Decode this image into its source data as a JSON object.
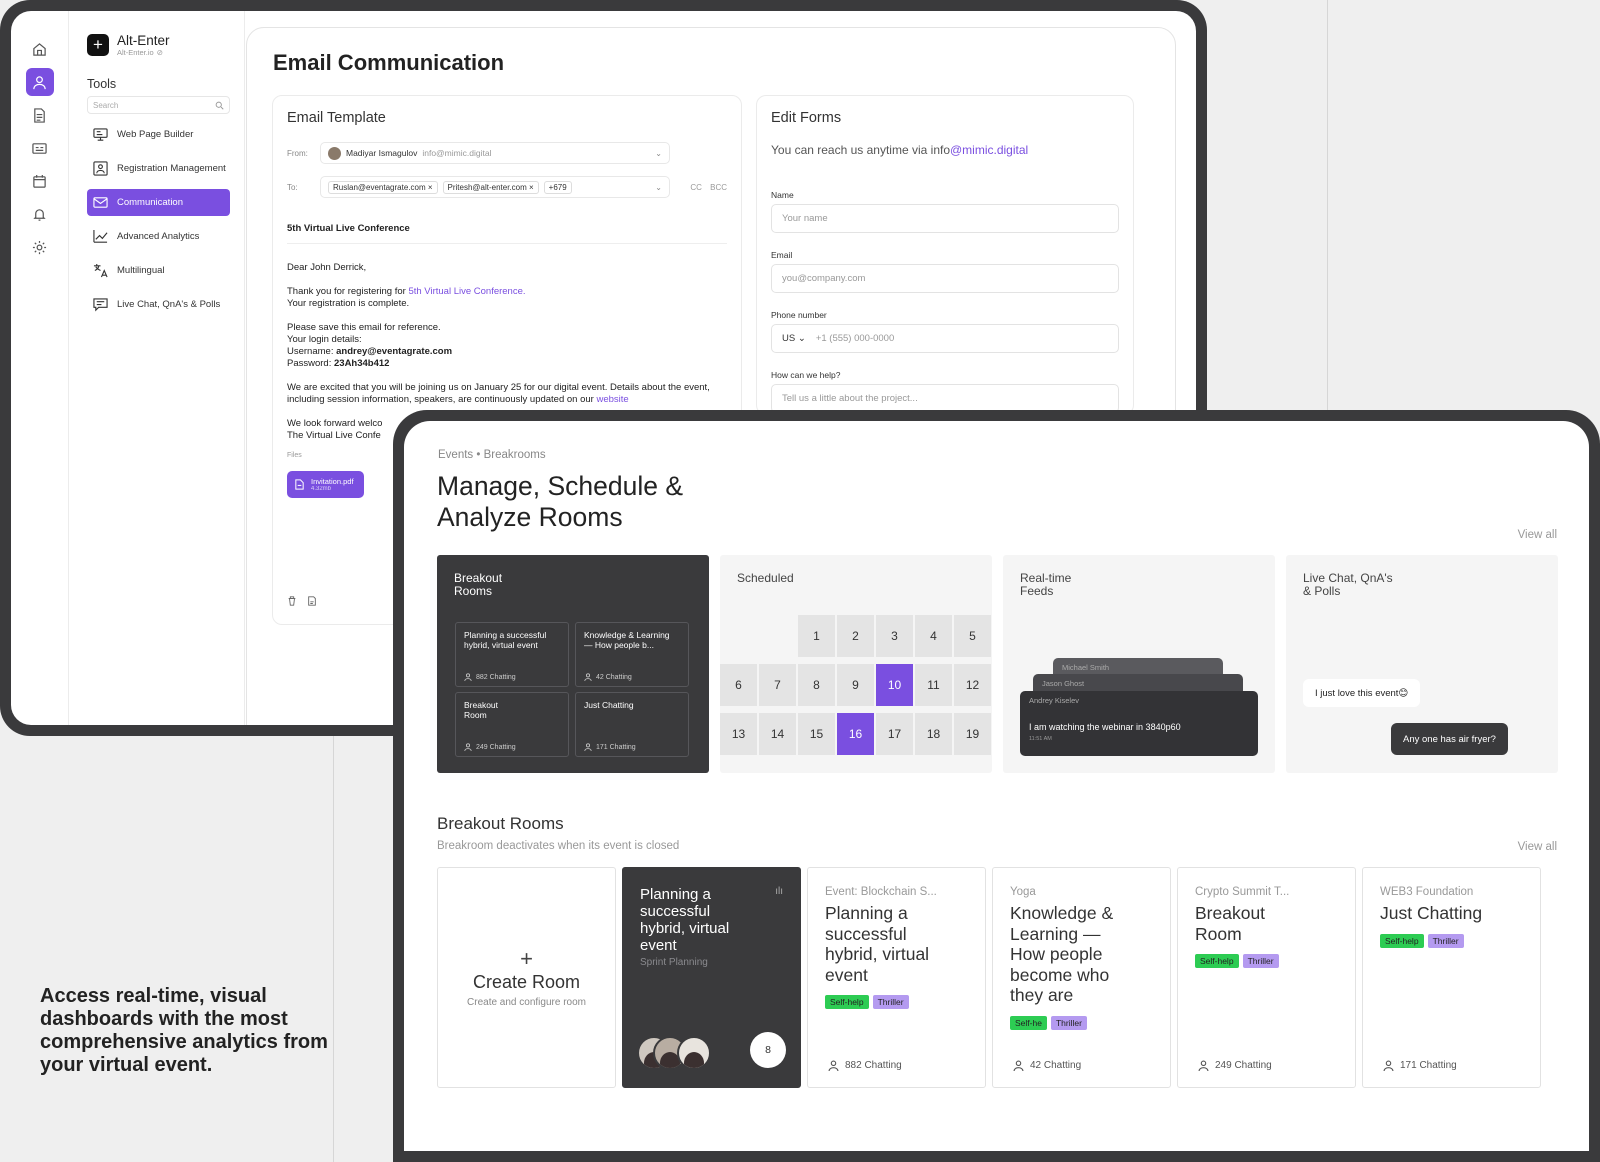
{
  "workspace": {
    "brand_name": "Alt-Enter",
    "brand_url": "Alt-Enter.io",
    "tools_title": "Tools",
    "search_placeholder": "Search",
    "tools": [
      {
        "label": "Web Page Builder",
        "icon": "monitor-icon"
      },
      {
        "label": "Registration Management",
        "icon": "registration-icon"
      },
      {
        "label": "Communication",
        "icon": "mail-icon",
        "active": true
      },
      {
        "label": "Advanced Analytics",
        "icon": "trend-icon"
      },
      {
        "label": "Multilingual",
        "icon": "translate-icon"
      },
      {
        "label": "Live Chat, QnA's & Polls",
        "icon": "chat-icon"
      }
    ],
    "rail_icons": [
      "home-icon",
      "user-icon",
      "document-icon",
      "ticket-icon",
      "calendar-icon",
      "bell-icon",
      "gear-icon"
    ],
    "accent": "#7a4fe0"
  },
  "email": {
    "page_title": "Email Communication",
    "template_title": "Email Template",
    "from_label": "From:",
    "from_name": "Madiyar Ismagulov",
    "from_email": "info@mimic.digital",
    "to_label": "To:",
    "to_chips": [
      "Ruslan@eventagrate.com ×",
      "Pritesh@alt-enter.com ×",
      "+679"
    ],
    "cc": "CC",
    "bcc": "BCC",
    "subject": "5th Virtual Live Conference",
    "greeting": "Dear John Derrick,",
    "thanks_prefix": "Thank you for registering for ",
    "thanks_link": "5th Virtual Live Conference.",
    "registration_complete": "Your registration is complete.",
    "save_line": "Please save this email for reference.",
    "login_details": "Your login details:",
    "username_label": "Username: ",
    "username": "andrey@eventagrate.com",
    "password_label": "Password: ",
    "password": "23Ah34b412",
    "excited_text": "We are excited that you will be joining us on January 25 for our digital event. Details about the event,  including session information, speakers, are continuously updated on our ",
    "website_link": "website",
    "look_forward": "We look forward welco",
    "signoff": "The Virtual Live Confe",
    "files_label": "Files",
    "file_name": "Invitation.pdf",
    "file_size": "4.32mb"
  },
  "forms": {
    "title": "Edit Forms",
    "reach_prefix": "You can reach us anytime via info",
    "reach_link": "@mimic.digital",
    "name_label": "Name",
    "name_placeholder": "Your name",
    "email_label": "Email",
    "email_placeholder": "you@company.com",
    "phone_label": "Phone number",
    "phone_country": "US",
    "phone_placeholder": "+1 (555) 000-0000",
    "help_label": "How can we help?",
    "help_placeholder": "Tell us a little about the project..."
  },
  "rooms_page": {
    "breadcrumb": "Events • Breakrooms",
    "title": "Manage, Schedule & Analyze Rooms",
    "view_all": "View all",
    "features": {
      "breakout": {
        "title": "Breakout Rooms",
        "tiles": [
          {
            "title": "Planning a successful hybrid, virtual event",
            "count": "882 Chatting"
          },
          {
            "title": "Knowledge & Learning — How people b...",
            "count": "42 Chatting"
          },
          {
            "title": "Breakout Room",
            "count": "249 Chatting"
          },
          {
            "title": "Just Chatting",
            "count": "171 Chatting"
          }
        ]
      },
      "scheduled": {
        "title": "Scheduled",
        "days": [
          "1",
          "2",
          "3",
          "4",
          "5",
          "6",
          "7",
          "8",
          "9",
          "10",
          "11",
          "12",
          "13",
          "14",
          "15",
          "16",
          "17",
          "18",
          "19"
        ],
        "selected": [
          "10",
          "16"
        ]
      },
      "feeds": {
        "title": "Real-time Feeds",
        "names": [
          "Michael Smith",
          "Jason Ghost",
          "Andrey Kiselev"
        ],
        "message": "I am watching the webinar in 3840p60",
        "time": "11:51 AM"
      },
      "chat": {
        "title": "Live Chat, QnA's & Polls",
        "bubble_light": "I just love this event😊",
        "bubble_dark": "Any one has air fryer?"
      }
    },
    "section_title": "Breakout Rooms",
    "section_sub": "Breakroom deactivates when its event is closed",
    "section_view_all": "View all",
    "create": {
      "title": "Create Room",
      "sub": "Create and configure room"
    },
    "dark_room": {
      "title": "Planning a successful hybrid, virtual event",
      "sub": "Sprint Planning",
      "count": "8"
    },
    "rooms": [
      {
        "event": "Event: Blockchain S...",
        "name": "Planning a successful hybrid, virtual event",
        "tags": [
          "Self-help",
          "Thriller"
        ],
        "count": "882 Chatting"
      },
      {
        "event": "Yoga",
        "name": "Knowledge & Learning — How people become who they are",
        "tags": [
          "Self-he",
          "Thriller"
        ],
        "count": "42 Chatting"
      },
      {
        "event": "Crypto Summit T...",
        "name": "Breakout Room",
        "tags": [
          "Self-help",
          "Thriller"
        ],
        "count": "249 Chatting"
      },
      {
        "event": "WEB3 Foundation",
        "name": "Just Chatting",
        "tags": [
          "Self-help",
          "Thriller"
        ],
        "count": "171 Chatting"
      }
    ]
  },
  "tagline": "Access real-time, visual dashboards with the most comprehensive analytics from your virtual event."
}
